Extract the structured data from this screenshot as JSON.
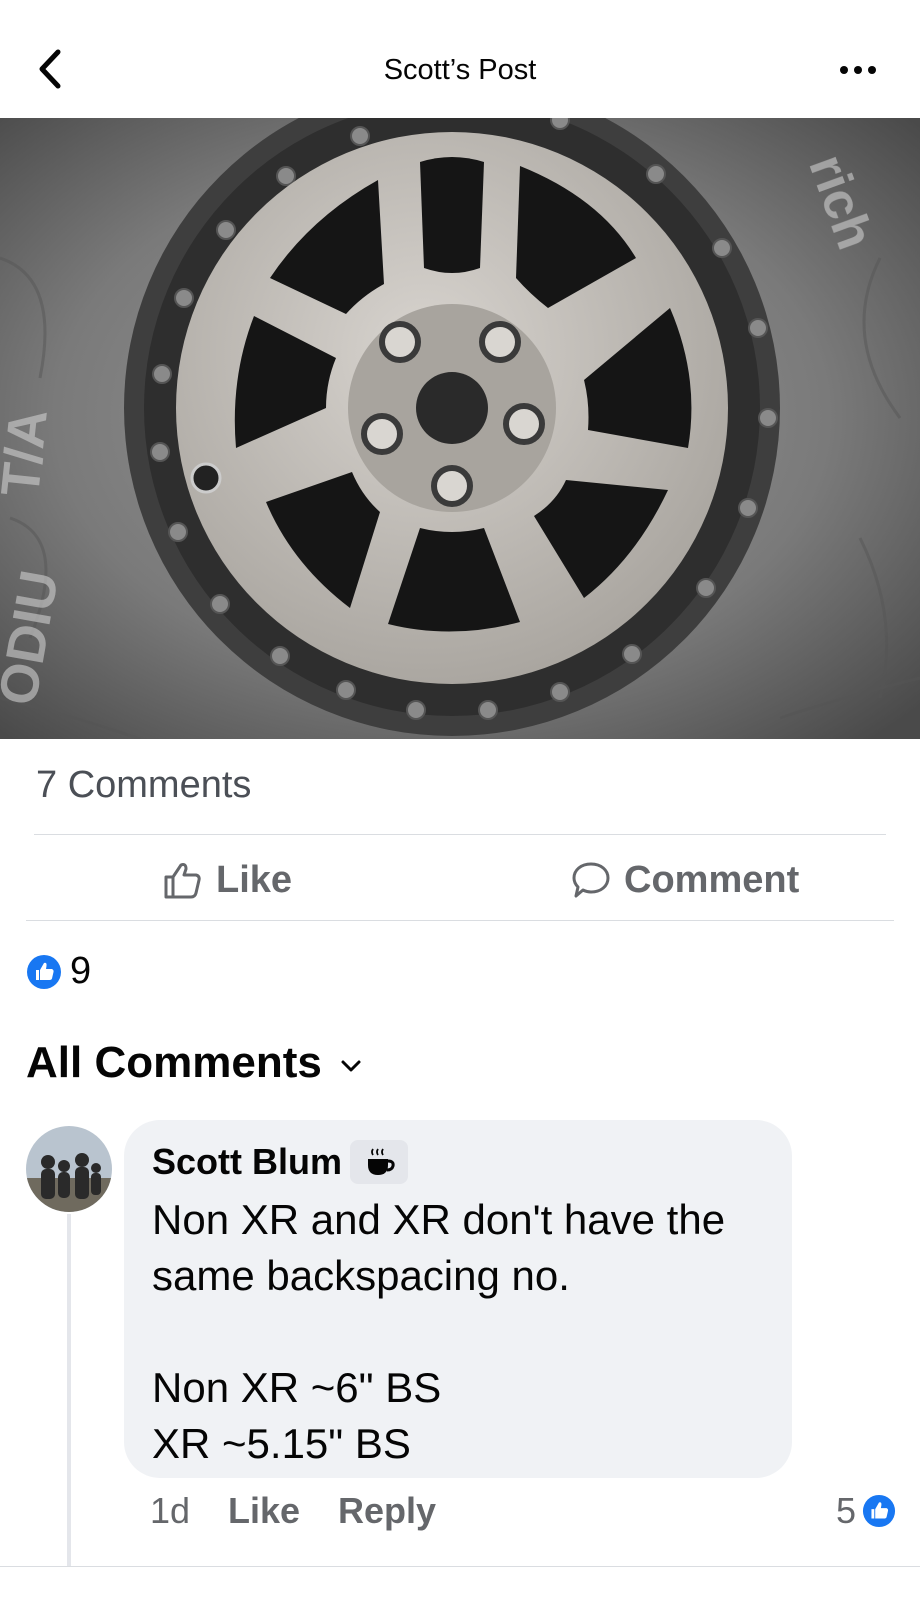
{
  "header": {
    "title": "Scott’s Post"
  },
  "post": {
    "comments_count": "7 Comments",
    "actions": {
      "like_label": "Like",
      "comment_label": "Comment"
    },
    "reactions_count": "9"
  },
  "comments_section": {
    "filter_label": "All Comments",
    "items": [
      {
        "author": "Scott Blum",
        "badge_icon": "coffee-cup-icon",
        "text": "Non XR and XR don't have the same backspacing no.\n\nNon XR ~6\" BS\nXR ~5.15\" BS",
        "time": "1d",
        "like_label": "Like",
        "reply_label": "Reply",
        "reaction_count": "5"
      }
    ]
  },
  "colors": {
    "like_blue": "#1877f2",
    "muted_text": "#65676b",
    "bubble_bg": "#f0f2f5"
  }
}
